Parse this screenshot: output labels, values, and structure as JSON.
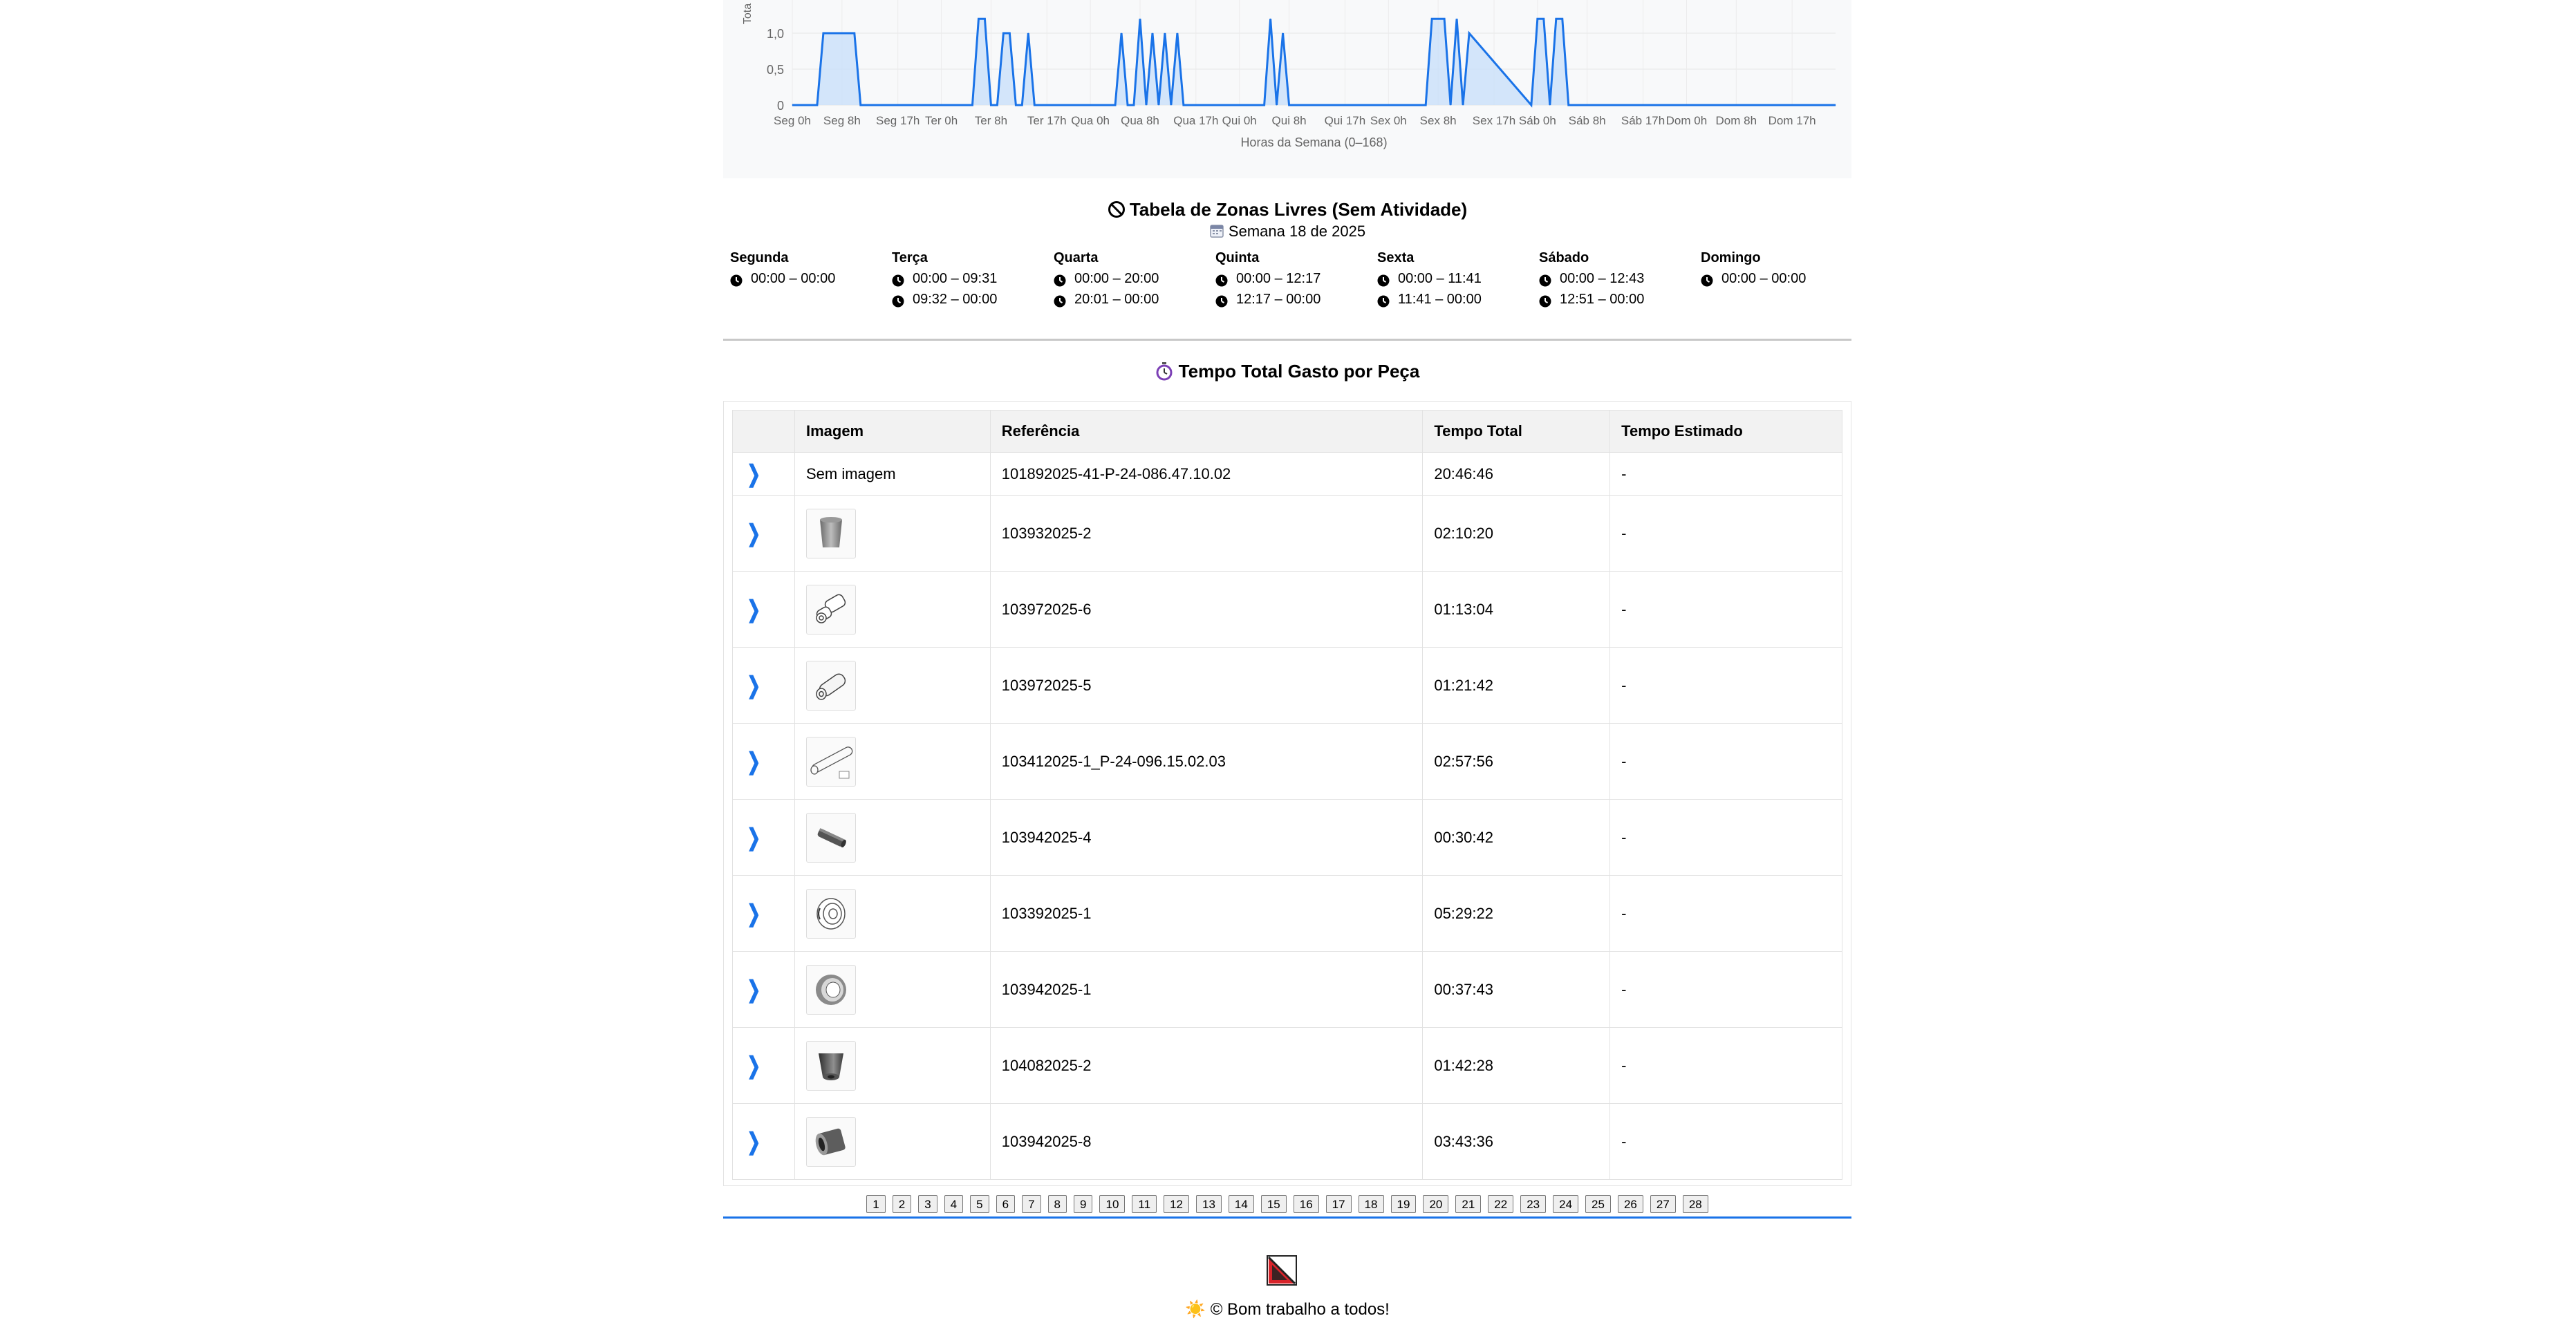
{
  "chart": {
    "y_axis_label": "Tota",
    "x_axis_label": "Horas da Semana (0–168)",
    "y_ticks": [
      "1,0",
      "0,5",
      "0"
    ],
    "x_ticks": [
      "Seg 0h",
      "Seg 8h",
      "Seg 17h",
      "Ter 0h",
      "Ter 8h",
      "Ter 17h",
      "Qua 0h",
      "Qua 8h",
      "Qua 17h",
      "Qui 0h",
      "Qui 8h",
      "Qui 17h",
      "Sex 0h",
      "Sex 8h",
      "Sex 17h",
      "Sáb 0h",
      "Sáb 8h",
      "Sáb 17h",
      "Dom 0h",
      "Dom 8h",
      "Dom 17h"
    ],
    "colors": {
      "line": "#1a73e8",
      "fill": "#c9e0fa",
      "background": "#f8f9fa"
    }
  },
  "chart_data": {
    "type": "area",
    "xlabel": "Horas da Semana (0–168)",
    "ylabel": "Tota",
    "xlim": [
      0,
      168
    ],
    "ylim": [
      0,
      1
    ],
    "grid": true,
    "x": [
      0,
      4,
      5,
      10,
      11,
      29,
      30,
      31,
      32,
      33,
      34,
      35,
      36,
      37,
      38,
      39,
      52,
      53,
      54,
      55,
      56,
      57,
      58,
      59,
      60,
      61,
      62,
      63,
      76,
      77,
      78,
      79,
      80,
      81,
      102,
      103,
      104,
      105,
      106,
      107,
      108,
      109,
      119,
      120,
      121,
      122,
      123,
      124,
      125,
      168
    ],
    "values": [
      0,
      0,
      1,
      1,
      0,
      0,
      1.2,
      1.2,
      0,
      0,
      1,
      1,
      0,
      0,
      1,
      0,
      0,
      1,
      0,
      0,
      1.2,
      0,
      1,
      0,
      1,
      0,
      1,
      0,
      0,
      1.2,
      0,
      1,
      0,
      0,
      0,
      1.2,
      1.2,
      1.2,
      0,
      1.2,
      0,
      1,
      0,
      1.2,
      1.2,
      0,
      1.2,
      1.2,
      0,
      0
    ]
  },
  "free_zones": {
    "title": "Tabela de Zonas Livres (Sem Atividade)",
    "subtitle": "Semana 18 de 2025",
    "days": [
      {
        "name": "Segunda",
        "slots": [
          "00:00 – 00:00"
        ]
      },
      {
        "name": "Terça",
        "slots": [
          "00:00 – 09:31",
          "09:32 – 00:00"
        ]
      },
      {
        "name": "Quarta",
        "slots": [
          "00:00 – 20:00",
          "20:01 – 00:00"
        ]
      },
      {
        "name": "Quinta",
        "slots": [
          "00:00 – 12:17",
          "12:17 – 00:00"
        ]
      },
      {
        "name": "Sexta",
        "slots": [
          "00:00 – 11:41",
          "11:41 – 00:00"
        ]
      },
      {
        "name": "Sábado",
        "slots": [
          "00:00 – 12:43",
          "12:51 – 00:00"
        ]
      },
      {
        "name": "Domingo",
        "slots": [
          "00:00 – 00:00"
        ]
      }
    ]
  },
  "parts_table": {
    "title": "Tempo Total Gasto por Peça",
    "headers": [
      "",
      "Imagem",
      "Referência",
      "Tempo Total",
      "Tempo Estimado"
    ],
    "rows": [
      {
        "image": "Sem imagem",
        "ref": "101892025-41-P-24-086.47.10.02",
        "total": "20:46:46",
        "est": "-",
        "icon": "no-image"
      },
      {
        "image": "",
        "ref": "103932025-2",
        "total": "02:10:20",
        "est": "-",
        "icon": "cup-part-icon"
      },
      {
        "image": "",
        "ref": "103972025-6",
        "total": "01:13:04",
        "est": "-",
        "icon": "stepped-shaft-icon"
      },
      {
        "image": "",
        "ref": "103972025-5",
        "total": "01:21:42",
        "est": "-",
        "icon": "cylinder-part-icon"
      },
      {
        "image": "",
        "ref": "103412025-1_P-24-096.15.02.03",
        "total": "02:57:56",
        "est": "-",
        "icon": "long-tube-icon"
      },
      {
        "image": "",
        "ref": "103942025-4",
        "total": "00:30:42",
        "est": "-",
        "icon": "dark-rod-icon"
      },
      {
        "image": "",
        "ref": "103392025-1",
        "total": "05:29:22",
        "est": "-",
        "icon": "flange-part-icon"
      },
      {
        "image": "",
        "ref": "103942025-1",
        "total": "00:37:43",
        "est": "-",
        "icon": "ring-part-icon"
      },
      {
        "image": "",
        "ref": "104082025-2",
        "total": "01:42:28",
        "est": "-",
        "icon": "cone-part-icon"
      },
      {
        "image": "",
        "ref": "103942025-8",
        "total": "03:43:36",
        "est": "-",
        "icon": "hollow-cylinder-icon"
      }
    ]
  },
  "pagination": {
    "pages": [
      "1",
      "2",
      "3",
      "4",
      "5",
      "6",
      "7",
      "8",
      "9",
      "10",
      "11",
      "12",
      "13",
      "14",
      "15",
      "16",
      "17",
      "18",
      "19",
      "20",
      "21",
      "22",
      "23",
      "24",
      "25",
      "26",
      "27",
      "28"
    ]
  },
  "footer": {
    "text": "© Bom trabalho a todos!",
    "sun_icon": "☀️"
  }
}
